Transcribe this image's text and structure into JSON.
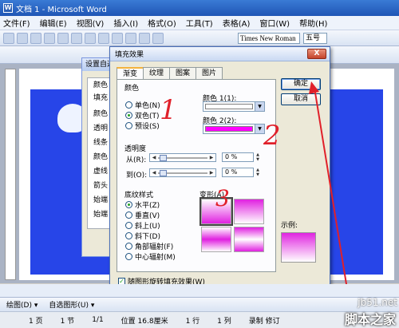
{
  "window": {
    "title": "文档 1 - Microsoft Word"
  },
  "menu": [
    "文件(F)",
    "编辑(E)",
    "视图(V)",
    "插入(I)",
    "格式(O)",
    "工具(T)",
    "表格(A)",
    "窗口(W)",
    "帮助(H)"
  ],
  "formatting": {
    "font": "Times New Roman",
    "size": "五号"
  },
  "background_dialog": {
    "title": "设置自选",
    "labels": [
      "颜色",
      "填充",
      "颜色",
      "透明",
      "线条",
      "颜色",
      "虚线",
      "箭头",
      "始端",
      "始端"
    ]
  },
  "dialog": {
    "title": "填充效果",
    "close_label": "X",
    "tabs": [
      "渐变",
      "纹理",
      "图案",
      "图片"
    ],
    "active_tab": "渐变",
    "color_group": "颜色",
    "color_options": [
      "单色(N)",
      "双色(T)",
      "预设(S)"
    ],
    "selected_color_option": "双色(T)",
    "color1_label": "颜色 1(1):",
    "color1_value": "#ffffff",
    "color2_label": "颜色 2(2):",
    "color2_value": "#ff00ff",
    "transparency_group": "透明度",
    "from_label": "从(R):",
    "from_value": "0 %",
    "to_label": "到(O):",
    "to_value": "0 %",
    "shading_group": "底纹样式",
    "shading_options": [
      "水平(Z)",
      "垂直(V)",
      "斜上(U)",
      "斜下(D)",
      "角部辐射(F)",
      "中心辐射(M)"
    ],
    "selected_shading": "水平(Z)",
    "variants_label": "变形(A)",
    "sample_label": "示例:",
    "rotate_label": "随图形旋转填充效果(W)",
    "rotate_checked": true,
    "ok_label": "确定",
    "cancel_label": "取消"
  },
  "annotations": [
    "1",
    "2",
    "3"
  ],
  "drawing_toolbar": {
    "draw_label": "绘图(D) ▾",
    "autoshape_label": "自选图形(U) ▾"
  },
  "status_bar": {
    "page": "1 页",
    "section": "1 节",
    "pages": "1/1",
    "position": "位置 16.8厘米",
    "line": "1 行",
    "column": "1 列",
    "mode": "录制 修订"
  },
  "watermark": {
    "site": "jb51.net",
    "brand": "脚本之家"
  }
}
